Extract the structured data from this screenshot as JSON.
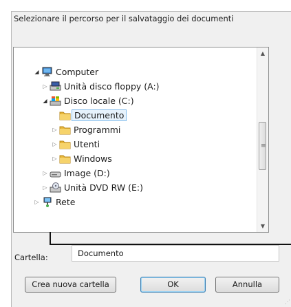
{
  "dialog": {
    "prompt": "Selezionare il percorso per il salvataggio dei documenti"
  },
  "tree": {
    "items": [
      {
        "label": "Computer",
        "icon": "computer-icon",
        "expander": "open"
      },
      {
        "label": "Unità disco floppy (A:)",
        "icon": "floppy-drive-icon",
        "expander": "collapsed"
      },
      {
        "label": "Disco locale (C:)",
        "icon": "local-disk-icon",
        "expander": "open"
      },
      {
        "label": "Documento",
        "icon": "folder-icon",
        "expander": "none",
        "selected": true
      },
      {
        "label": "Programmi",
        "icon": "folder-icon",
        "expander": "collapsed"
      },
      {
        "label": "Utenti",
        "icon": "folder-icon",
        "expander": "collapsed"
      },
      {
        "label": "Windows",
        "icon": "folder-icon",
        "expander": "collapsed"
      },
      {
        "label": "Image (D:)",
        "icon": "removable-drive-icon",
        "expander": "collapsed"
      },
      {
        "label": "Unità DVD RW (E:)",
        "icon": "dvd-drive-icon",
        "expander": "collapsed"
      },
      {
        "label": "Rete",
        "icon": "network-icon",
        "expander": "collapsed"
      }
    ]
  },
  "folder": {
    "label": "Cartella:",
    "value": "Documento"
  },
  "buttons": {
    "new_folder": "Crea nuova cartella",
    "ok": "OK",
    "cancel": "Annulla"
  },
  "colors": {
    "selection_bg": "#e6f2fc",
    "selection_border": "#82bcec",
    "folder": "#e8b73a"
  }
}
